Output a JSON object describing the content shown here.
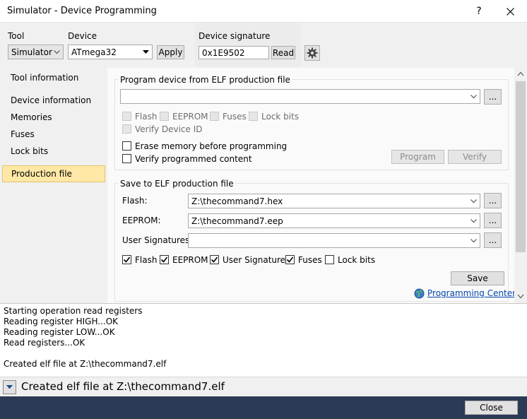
{
  "window": {
    "title": "Simulator - Device Programming",
    "help_label": "?",
    "close_glyph": "✕"
  },
  "header": {
    "tool_label": "Tool",
    "tool_value": "Simulator",
    "device_label": "Device",
    "device_value": "ATmega32",
    "apply_label": "Apply",
    "signature_label": "Device signature",
    "signature_value": "0x1E9502",
    "read_label": "Read",
    "settings_icon": "gear-icon"
  },
  "sidebar": {
    "items": [
      {
        "label": "Tool information"
      },
      {
        "label": "Device information"
      },
      {
        "label": "Memories"
      },
      {
        "label": "Fuses"
      },
      {
        "label": "Lock bits"
      },
      {
        "label": "Production file",
        "selected": true
      }
    ]
  },
  "program_group": {
    "title": "Program device from ELF production file",
    "file_value": "",
    "browse_label": "...",
    "cb_flash": "Flash",
    "cb_eeprom": "EEPROM",
    "cb_fuses": "Fuses",
    "cb_lockbits": "Lock bits",
    "cb_verify_id": "Verify Device ID",
    "cb_erase": "Erase memory before programming",
    "cb_verify_content": "Verify programmed content",
    "program_label": "Program",
    "verify_label": "Verify"
  },
  "save_group": {
    "title": "Save to ELF production file",
    "flash_label": "Flash:",
    "flash_value": "Z:\\thecommand7.hex",
    "eeprom_label": "EEPROM:",
    "eeprom_value": "Z:\\thecommand7.eep",
    "usersig_label": "User Signatures:",
    "usersig_value": "",
    "browse_label": "...",
    "cb_flash": "Flash",
    "cb_eeprom": "EEPROM",
    "cb_usersig": "User Signatures",
    "cb_fuses": "Fuses",
    "cb_lockbits": "Lock bits",
    "save_label": "Save",
    "programming_center": "Programming Center"
  },
  "log": {
    "lines": [
      "Starting operation read registers",
      "Reading register HIGH...OK",
      "Reading register LOW...OK",
      "Read registers...OK",
      "",
      "Created elf file at Z:\\thecommand7.elf"
    ]
  },
  "status": {
    "message": "Created elf file at Z:\\thecommand7.elf"
  },
  "footer": {
    "close_label": "Close"
  },
  "colors": {
    "selected_nav": "#ffe8a6",
    "footer_bar": "#2b3a55",
    "link": "#0645ad"
  }
}
